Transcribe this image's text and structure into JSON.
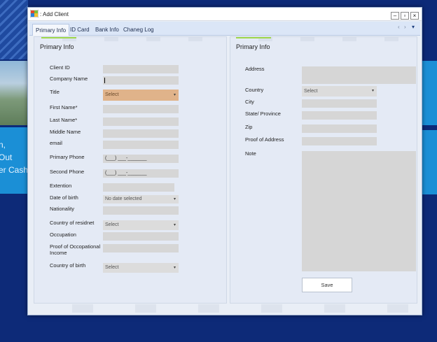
{
  "desktop": {
    "tile_text_lines": [
      "n,",
      "Out",
      "er Cash"
    ]
  },
  "window": {
    "title": ": Add Client",
    "controls": {
      "minimize": "–",
      "maximize": "▫",
      "close": "×"
    }
  },
  "tabs": [
    {
      "label": "Primary Info",
      "active": true
    },
    {
      "label": "ID Card",
      "active": false
    },
    {
      "label": "Bank Info",
      "active": false
    },
    {
      "label": "Chaneg Log",
      "active": false
    }
  ],
  "tab_nav": {
    "prev": "‹",
    "next": "›",
    "menu": "▾"
  },
  "left_panel": {
    "title": "Primary Info",
    "fields": [
      {
        "label": "Client ID",
        "value": ""
      },
      {
        "label": "Company Name",
        "value": ""
      },
      {
        "label": "Title",
        "value": "Select"
      },
      {
        "label": "First Name*",
        "value": ""
      },
      {
        "label": "Last Name*",
        "value": ""
      },
      {
        "label": "Middle Name",
        "value": ""
      },
      {
        "label": "email",
        "value": ""
      },
      {
        "label": "Primary Phone",
        "value": "(___) ___-_______"
      },
      {
        "label": "Second Phone",
        "value": "(___) ___-_______"
      },
      {
        "label": "Extention",
        "value": ""
      },
      {
        "label": "Date of birth",
        "value": "No date selected"
      },
      {
        "label": "Nationality",
        "value": ""
      },
      {
        "label": "Country of residnet",
        "value": "Select"
      },
      {
        "label": "Occupation",
        "value": ""
      },
      {
        "label": "Proof of Occopational Income",
        "value": ""
      },
      {
        "label": "Country of birth",
        "value": "Select"
      }
    ]
  },
  "right_panel": {
    "title": "Primary Info",
    "fields": [
      {
        "label": "Address",
        "value": ""
      },
      {
        "label": "Country",
        "value": "Select"
      },
      {
        "label": "City",
        "value": ""
      },
      {
        "label": "State/ Province",
        "value": ""
      },
      {
        "label": "Zip",
        "value": ""
      },
      {
        "label": "Proof of Address",
        "value": ""
      },
      {
        "label": "Note",
        "value": ""
      }
    ],
    "save_label": "Save"
  },
  "colors": {
    "title_select": "#e0b38a",
    "field_bg": "#d6d6d6",
    "accent": "#9fd84c",
    "desktop_bg": "#0d2a78",
    "tile": "#1b8fd6"
  }
}
